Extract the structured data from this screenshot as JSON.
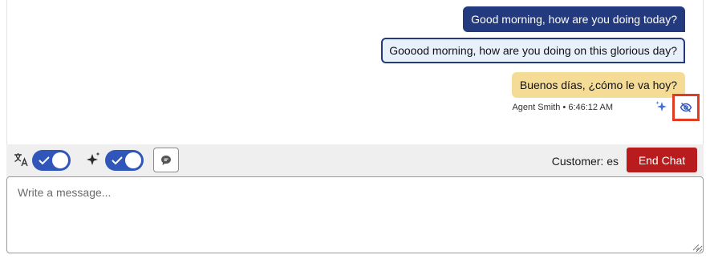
{
  "messages": [
    {
      "text": "Good morning, how are you doing today?",
      "role": "agent-original"
    },
    {
      "text": "Gooood morning, how are you doing on this glorious day?",
      "role": "agent-enhanced"
    },
    {
      "text": "Buenos días, ¿cómo le va hoy?",
      "role": "translated"
    }
  ],
  "message_meta": "Agent Smith • 6:46:12 AM",
  "toolbar": {
    "translate_icon": "translate-icon",
    "translate_enabled": true,
    "ai_icon": "sparkle-icon",
    "ai_enabled": true,
    "chat_icon": "chat-bubble-icon",
    "customer_language": "Customer: es",
    "end_chat_label": "End Chat"
  },
  "composer": {
    "placeholder": "Write a message...",
    "value": ""
  },
  "colors": {
    "agent_bubble": "#233a7e",
    "enhanced_bubble": "#e8f0fb",
    "translated_bubble": "#f4dc96",
    "toggle_on": "#2f56b8",
    "end_chat": "#b91c1c",
    "highlight": "#e33b22"
  }
}
